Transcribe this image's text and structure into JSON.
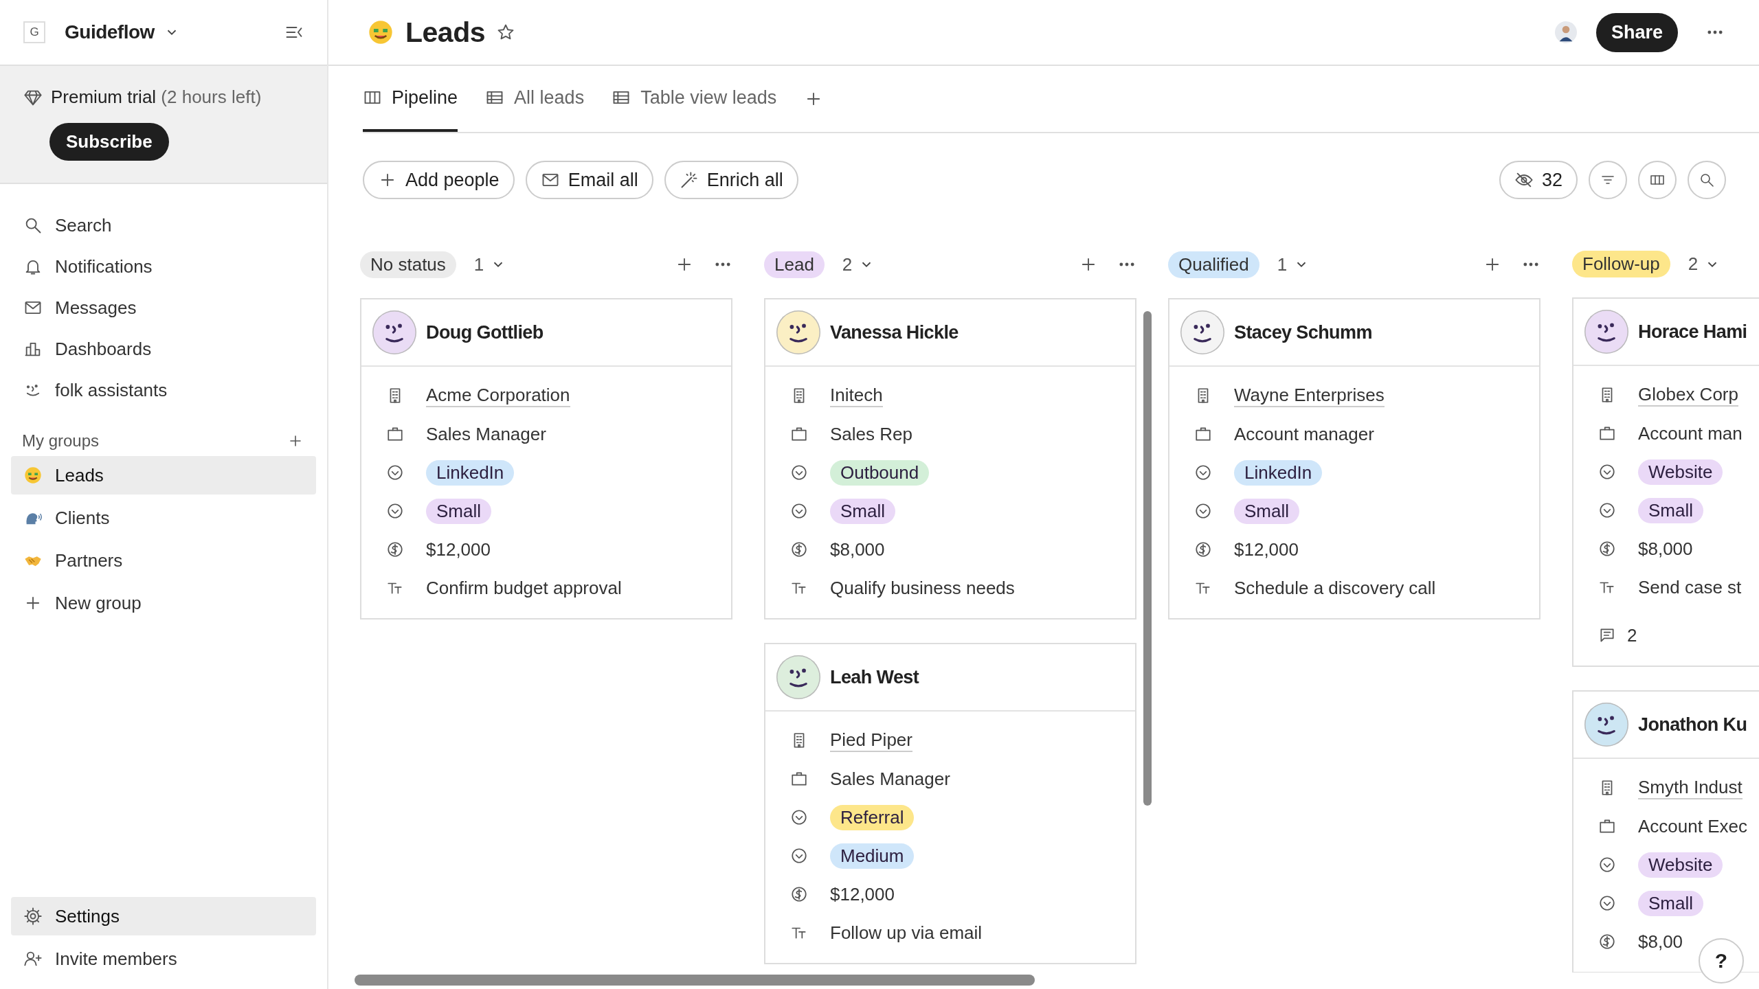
{
  "workspace": {
    "initial": "G",
    "name": "Guideflow"
  },
  "trial": {
    "label": "Premium trial",
    "remaining": "(2 hours left)",
    "button": "Subscribe"
  },
  "nav": [
    {
      "label": "Search"
    },
    {
      "label": "Notifications"
    },
    {
      "label": "Messages"
    },
    {
      "label": "Dashboards"
    },
    {
      "label": "folk assistants"
    }
  ],
  "groups": {
    "title": "My groups",
    "items": [
      {
        "label": "Leads",
        "selected": true
      },
      {
        "label": "Clients",
        "selected": false
      },
      {
        "label": "Partners",
        "selected": false
      }
    ],
    "new_group": "New group"
  },
  "footer_nav": [
    {
      "label": "Settings",
      "selected": true
    },
    {
      "label": "Invite members",
      "selected": false
    }
  ],
  "page": {
    "title": "Leads",
    "share": "Share"
  },
  "tabs": [
    {
      "label": "Pipeline",
      "selected": true
    },
    {
      "label": "All leads",
      "selected": false
    },
    {
      "label": "Table view leads",
      "selected": false
    }
  ],
  "toolbar": {
    "buttons": [
      "Add people",
      "Email all",
      "Enrich all"
    ],
    "hidden_count": "32"
  },
  "columns": [
    {
      "status": "No status",
      "color": "#ebebeb",
      "count": "1",
      "cards": [
        {
          "name": "Doug Gottlieb",
          "color": "#eadcf5",
          "company": "Acme Corporation",
          "job_title": "Sales Manager",
          "source": {
            "label": "LinkedIn",
            "color": "#cfe6fa"
          },
          "size": {
            "label": "Small",
            "color": "#ead9f7"
          },
          "amount": "$12,000",
          "next_step": "Confirm budget approval"
        }
      ]
    },
    {
      "status": "Lead",
      "color": "#ead9f7",
      "count": "2",
      "cards": [
        {
          "name": "Vanessa Hickle",
          "color": "#fbefc4",
          "company": "Initech",
          "job_title": "Sales Rep",
          "source": {
            "label": "Outbound",
            "color": "#d3efd8"
          },
          "size": {
            "label": "Small",
            "color": "#ead9f7"
          },
          "amount": "$8,000",
          "next_step": "Qualify business needs"
        },
        {
          "name": "Leah West",
          "color": "#ddeedd",
          "company": "Pied Piper",
          "job_title": "Sales Manager",
          "source": {
            "label": "Referral",
            "color": "#fde68a"
          },
          "size": {
            "label": "Medium",
            "color": "#cfe6fa"
          },
          "amount": "$12,000",
          "next_step": "Follow up via email"
        }
      ]
    },
    {
      "status": "Qualified",
      "color": "#cfe6fa",
      "count": "1",
      "cards": [
        {
          "name": "Stacey Schumm",
          "color": "#f4f4f4",
          "company": "Wayne Enterprises",
          "job_title": "Account manager",
          "source": {
            "label": "LinkedIn",
            "color": "#cfe6fa"
          },
          "size": {
            "label": "Small",
            "color": "#ead9f7"
          },
          "amount": "$12,000",
          "next_step": "Schedule a discovery call"
        }
      ]
    },
    {
      "status": "Follow-up",
      "color": "#fde68a",
      "count": "2",
      "cards": [
        {
          "name": "Horace Hami",
          "color": "#eadcf5",
          "company": "Globex Corp",
          "job_title": "Account man",
          "source": {
            "label": "Website",
            "color": "#ead9f7"
          },
          "size": {
            "label": "Small",
            "color": "#ead9f7"
          },
          "amount": "$8,000",
          "next_step": "Send case st",
          "comments": "2"
        },
        {
          "name": "Jonathon Ku",
          "color": "#cde6f3",
          "company": "Smyth Indust",
          "job_title": "Account Exec",
          "source": {
            "label": "Website",
            "color": "#ead9f7"
          },
          "size": {
            "label": "Small",
            "color": "#ead9f7"
          },
          "amount": "$8,00"
        }
      ]
    }
  ],
  "help": "?"
}
